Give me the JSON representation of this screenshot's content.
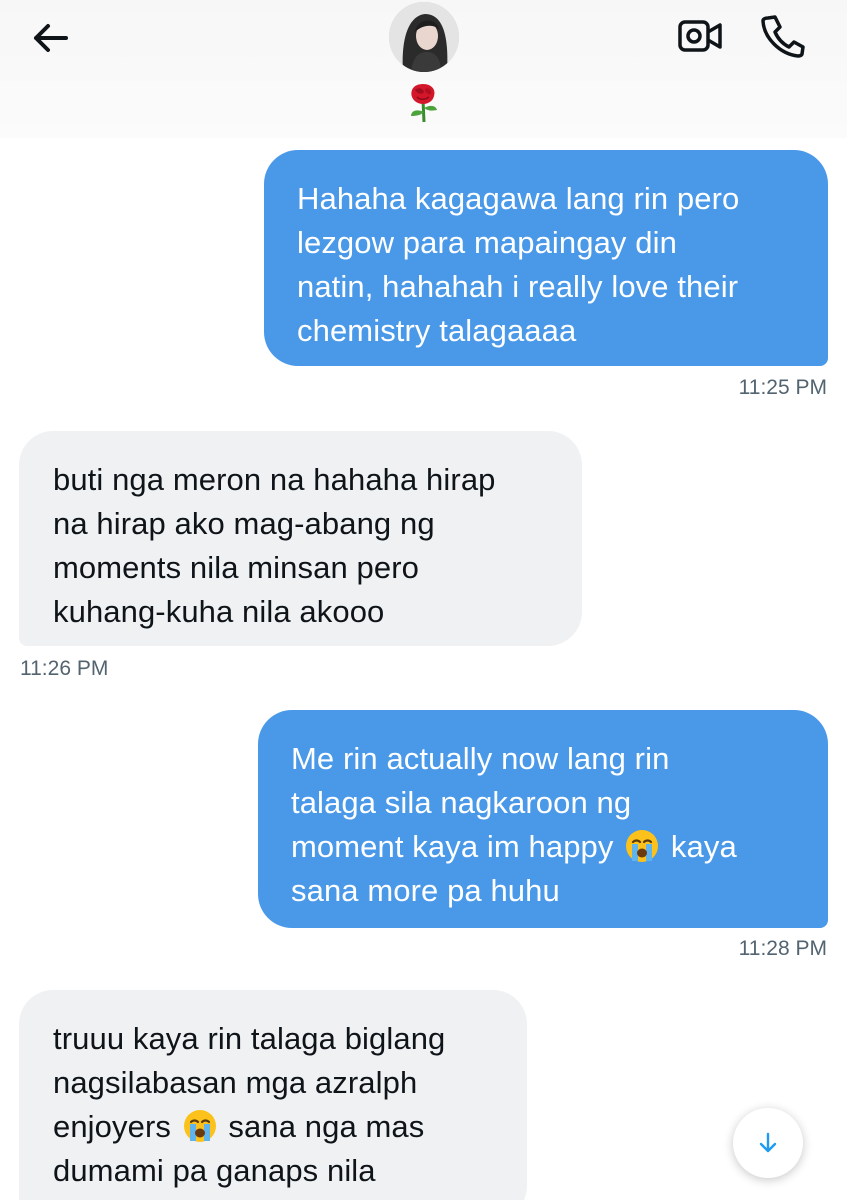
{
  "header": {
    "contact_emoji": "🌹",
    "back_icon": "arrow-left-icon",
    "video_icon": "video-camera-icon",
    "call_icon": "phone-icon"
  },
  "messages": [
    {
      "direction": "sent",
      "lines": [
        "Hahaha kagagawa lang rin pero",
        "lezgow para mapaingay din",
        "natin, hahahah i really love their",
        "chemistry talagaaaa"
      ],
      "time": "11:25 PM"
    },
    {
      "direction": "received",
      "lines": [
        "buti nga meron na hahaha hirap",
        "na hirap ako mag-abang ng",
        "moments nila minsan pero",
        "kuhang-kuha nila akooo"
      ],
      "time": "11:26 PM"
    },
    {
      "direction": "sent",
      "lines": [
        "Me rin actually now lang rin",
        "talaga sila nagkaroon ng",
        "moment kaya im happy",
        "kaya",
        "sana more pa huhu"
      ],
      "time": "11:28 PM"
    },
    {
      "direction": "received",
      "lines": [
        "truuu kaya rin talaga biglang",
        "nagsilabasan mga azralph",
        "enjoyers",
        "sana nga mas",
        "dumami pa ganaps nila"
      ],
      "time": ""
    }
  ],
  "inline_emoji": "loudly-crying-face-icon",
  "scroll_button": {
    "icon": "arrow-down-icon"
  },
  "colors": {
    "sent_bubble": "#4a99e9",
    "received_bubble": "#eff1f3",
    "timestamp": "#536471",
    "accent": "#1d9bf0"
  }
}
